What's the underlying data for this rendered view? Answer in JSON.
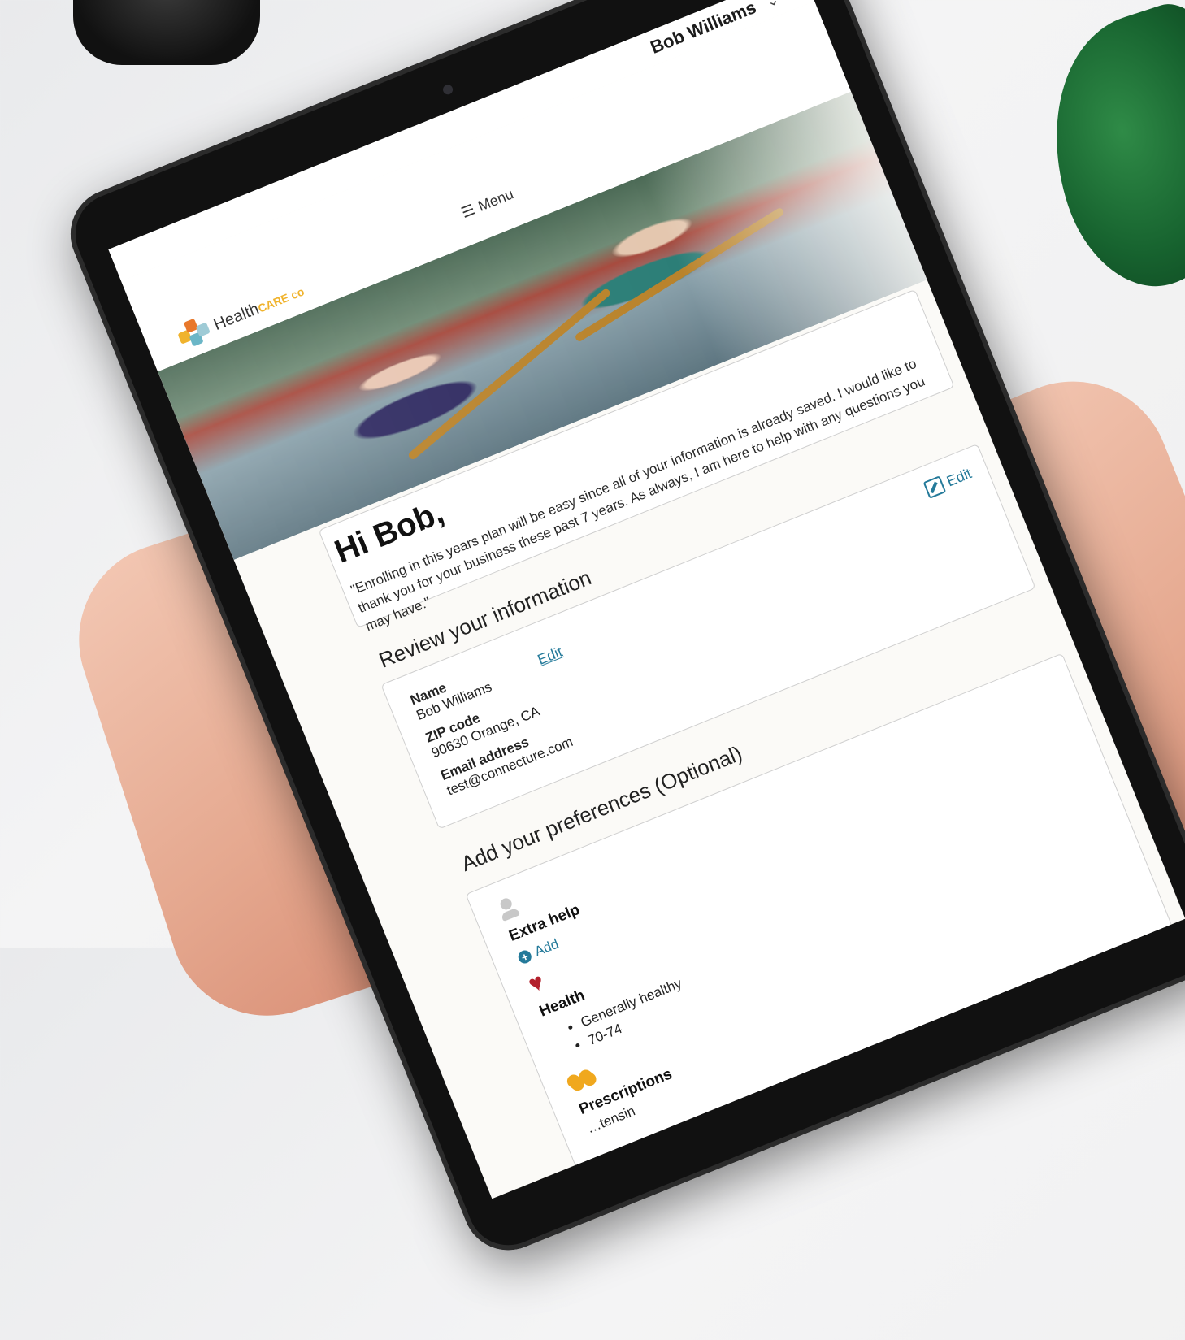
{
  "header": {
    "user_name": "Bob Williams",
    "menu_label": "Menu"
  },
  "brand": {
    "logo_prefix": "Health",
    "logo_suffix": "CARE co",
    "accent_color": "#f0b32d"
  },
  "intro": {
    "greeting": "Hi Bob,",
    "quote": "\"Enrolling in this years plan will be easy since all of your information is already saved. I would like to thank you for your business these past 7 years. As always, I am here to help with any questions you may have.\""
  },
  "review": {
    "title": "Review your information",
    "edit_label": "Edit",
    "name_label": "Name",
    "name_value": "Bob Williams",
    "zip_label": "ZIP code",
    "zip_value": "90630 Orange, CA",
    "email_label": "Email address",
    "email_value": "test@connecture.com",
    "inline_edit_label": "Edit"
  },
  "preferences": {
    "title": "Add your preferences (Optional)",
    "extra_help": {
      "title": "Extra help",
      "add_label": "Add",
      "icon": "person-icon"
    },
    "health": {
      "title": "Health",
      "items": [
        "Generally healthy",
        "70-74"
      ],
      "icon": "heart-icon"
    },
    "prescriptions": {
      "title": "Prescriptions",
      "sub_text": "…tensin",
      "icon": "pills-icon"
    }
  }
}
